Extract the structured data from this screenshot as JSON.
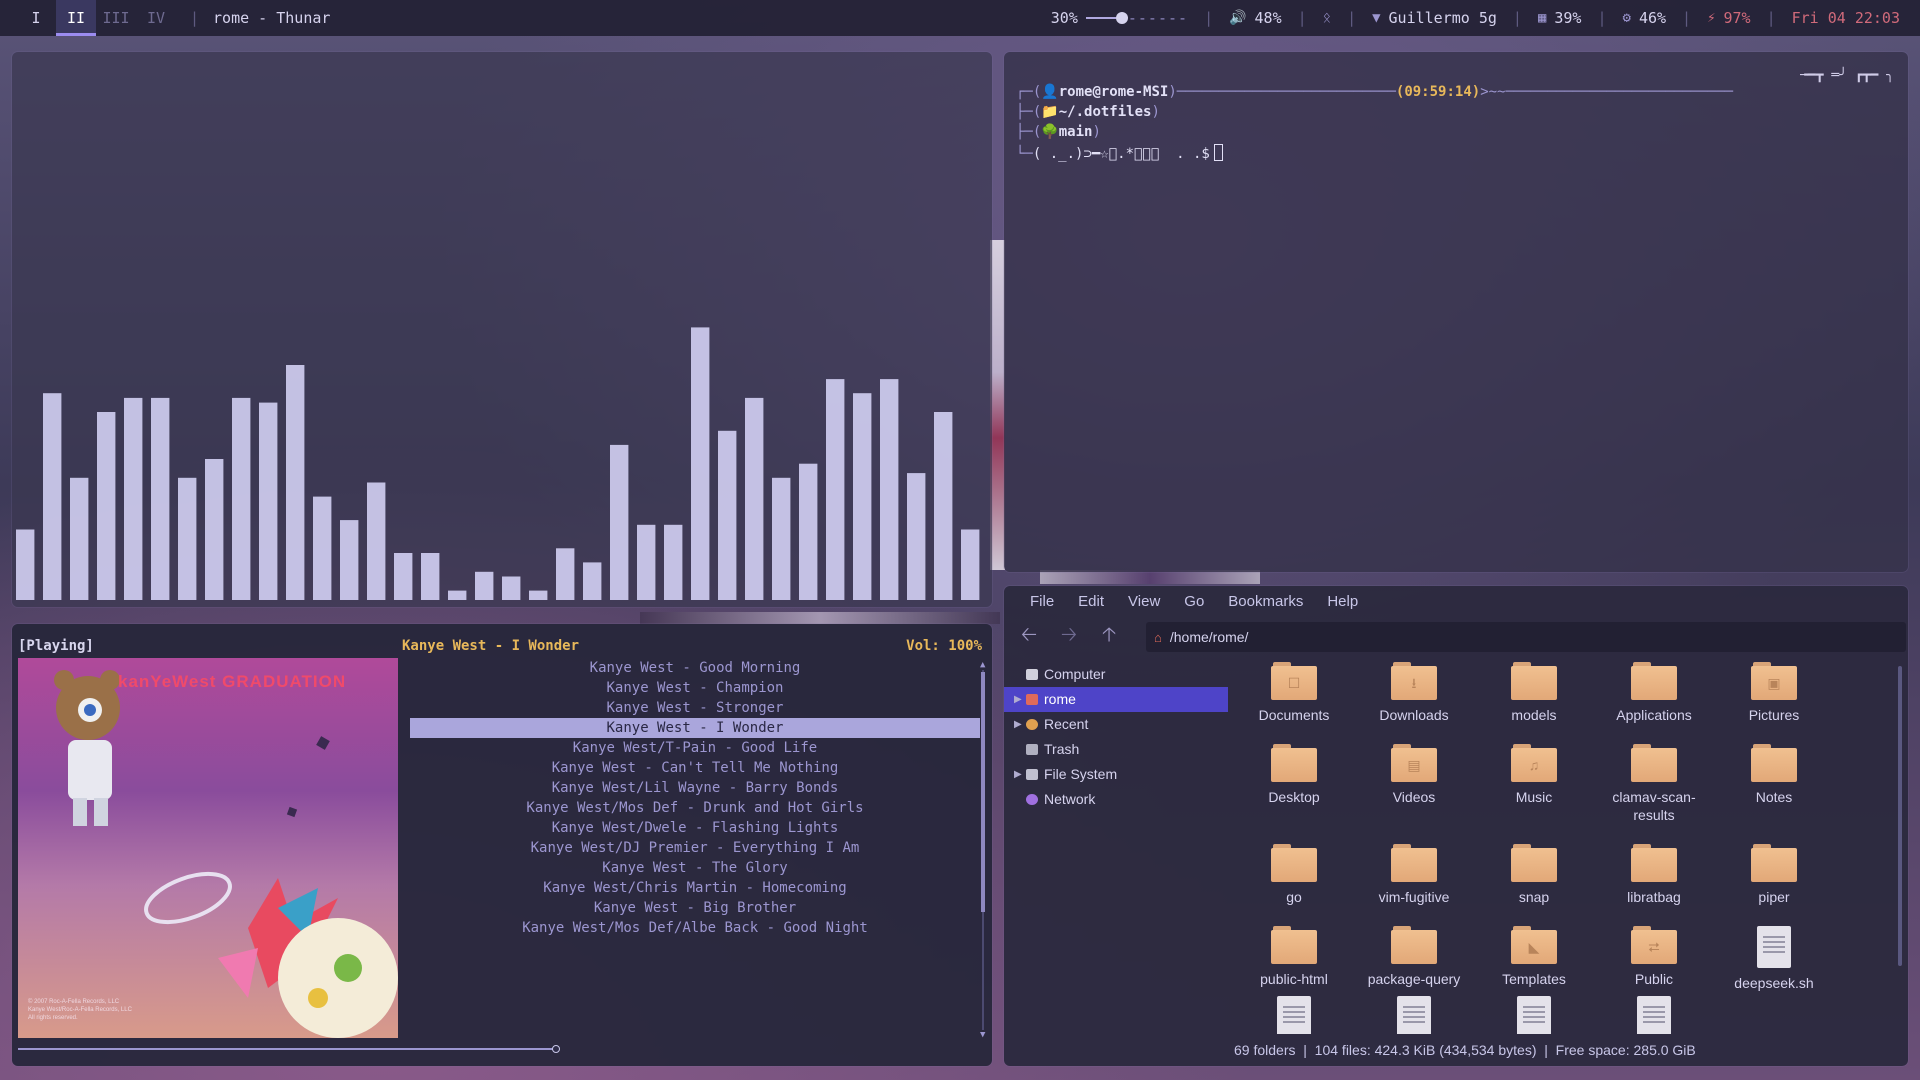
{
  "topbar": {
    "workspaces": [
      "I",
      "II",
      "III",
      "IV"
    ],
    "active_workspace": "II",
    "window_title": "rome - Thunar",
    "brightness": "30%",
    "brightness_level": 0.3,
    "volume": "48%",
    "network": "Guillermo 5g",
    "memory": "39%",
    "cpu": "46%",
    "battery": "97%",
    "clock": "Fri 04 22:03",
    "icons": {
      "volume": "speaker-icon",
      "bluetooth": "bluetooth-icon",
      "network": "wifi-icon",
      "memory": "memory-icon",
      "cpu": "cpu-icon",
      "battery": "battery-icon"
    },
    "accent_color": "#d06a7a"
  },
  "terminal": {
    "user_host": "rome@rome-MSI",
    "time": "(09:59:14)",
    "tail": ">~~",
    "directory": "~/.dotfiles",
    "branch": "main",
    "prompt": "( ._.)⊃━☆ﾟ.*･｡ﾟ  . .$"
  },
  "player": {
    "status": "[Playing]",
    "now_playing": "Kanye West - I Wonder",
    "volume": "Vol: 100%",
    "album_title": "kanYeWest GRADUATION",
    "album_fine_print": "© 2007 Roc-A-Fella Records, LLC\nKanye West/Roc-A-Fella Records, LLC\nAll rights reserved.",
    "selected_index": 3,
    "progress": 0.56,
    "playlist": [
      "Kanye West - Good Morning",
      "Kanye West - Champion",
      "Kanye West - Stronger",
      "Kanye West - I Wonder",
      "Kanye West/T-Pain - Good Life",
      "Kanye West - Can't Tell Me Nothing",
      "Kanye West/Lil Wayne - Barry Bonds",
      "Kanye West/Mos Def - Drunk and Hot Girls",
      "Kanye West/Dwele - Flashing Lights",
      "Kanye West/DJ Premier - Everything I Am",
      "Kanye West - The Glory",
      "Kanye West/Chris Martin - Homecoming",
      "Kanye West - Big Brother",
      "Kanye West/Mos Def/Albe Back - Good Night"
    ]
  },
  "visualizer": {
    "bar_color": "#cfcdf0",
    "levels": [
      0.15,
      0.44,
      0.26,
      0.4,
      0.43,
      0.43,
      0.26,
      0.3,
      0.43,
      0.42,
      0.5,
      0.22,
      0.17,
      0.25,
      0.1,
      0.1,
      0.02,
      0.06,
      0.05,
      0.02,
      0.11,
      0.08,
      0.33,
      0.16,
      0.16,
      0.58,
      0.36,
      0.43,
      0.26,
      0.29,
      0.47,
      0.44,
      0.47,
      0.27,
      0.4,
      0.15
    ]
  },
  "thunar": {
    "menu": [
      "File",
      "Edit",
      "View",
      "Go",
      "Bookmarks",
      "Help"
    ],
    "location": "/home/rome/",
    "sidebar": [
      {
        "label": "Computer",
        "icon": "computer-icon",
        "expander": false,
        "selected": false
      },
      {
        "label": "rome",
        "icon": "home-icon",
        "expander": true,
        "selected": true
      },
      {
        "label": "Recent",
        "icon": "recent-icon",
        "expander": true,
        "selected": false
      },
      {
        "label": "Trash",
        "icon": "trash-icon",
        "expander": false,
        "selected": false
      },
      {
        "label": "File System",
        "icon": "drive-icon",
        "expander": true,
        "selected": false
      },
      {
        "label": "Network",
        "icon": "network-icon",
        "expander": false,
        "selected": false
      }
    ],
    "files": [
      {
        "name": "Documents",
        "kind": "folder",
        "icon": "documents-folder-icon"
      },
      {
        "name": "Downloads",
        "kind": "folder",
        "icon": "downloads-folder-icon"
      },
      {
        "name": "models",
        "kind": "folder",
        "icon": "folder-icon"
      },
      {
        "name": "Applications",
        "kind": "folder",
        "icon": "folder-icon"
      },
      {
        "name": "Pictures",
        "kind": "folder",
        "icon": "pictures-folder-icon"
      },
      {
        "name": "Desktop",
        "kind": "folder",
        "icon": "folder-icon"
      },
      {
        "name": "Videos",
        "kind": "folder",
        "icon": "videos-folder-icon"
      },
      {
        "name": "Music",
        "kind": "folder",
        "icon": "music-folder-icon"
      },
      {
        "name": "clamav-scan-results",
        "kind": "folder",
        "icon": "folder-icon"
      },
      {
        "name": "Notes",
        "kind": "folder",
        "icon": "folder-icon"
      },
      {
        "name": "go",
        "kind": "folder",
        "icon": "folder-icon"
      },
      {
        "name": "vim-fugitive",
        "kind": "folder",
        "icon": "folder-icon"
      },
      {
        "name": "snap",
        "kind": "folder",
        "icon": "folder-icon"
      },
      {
        "name": "libratbag",
        "kind": "folder",
        "icon": "folder-icon"
      },
      {
        "name": "piper",
        "kind": "folder",
        "icon": "folder-icon"
      },
      {
        "name": "public-html",
        "kind": "folder",
        "icon": "folder-icon"
      },
      {
        "name": "package-query",
        "kind": "folder",
        "icon": "folder-icon"
      },
      {
        "name": "Templates",
        "kind": "folder",
        "icon": "templates-folder-icon"
      },
      {
        "name": "Public",
        "kind": "folder",
        "icon": "public-folder-icon"
      },
      {
        "name": "deepseek.sh",
        "kind": "file",
        "icon": "script-file-icon"
      },
      {
        "name": "",
        "kind": "file",
        "icon": "file-icon"
      },
      {
        "name": "",
        "kind": "file",
        "icon": "text-file-icon"
      },
      {
        "name": "",
        "kind": "file",
        "icon": "text-file-icon"
      },
      {
        "name": "",
        "kind": "file",
        "icon": "text-file-icon"
      }
    ],
    "status": "69 folders  |  104 files: 424.3 KiB (434,534 bytes)  |  Free space: 285.0 GiB",
    "selection_color": "#4e44c8"
  }
}
